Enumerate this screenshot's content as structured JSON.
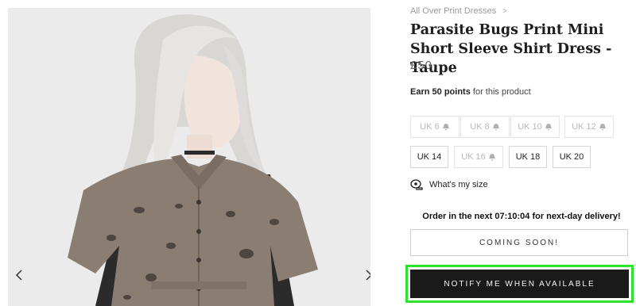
{
  "breadcrumb": {
    "category": "All Over Print Dresses",
    "separator": ">"
  },
  "product": {
    "title": "Parasite Bugs Print Mini Short Sleeve Shirt Dress - Taupe",
    "price": "£50",
    "points_prefix": "Earn",
    "points_value": "50 points",
    "points_suffix": "for this product"
  },
  "sizes": [
    {
      "label": "UK 6",
      "available": false
    },
    {
      "label": "UK 8",
      "available": false
    },
    {
      "label": "UK 10",
      "available": false
    },
    {
      "label": "UK 12",
      "available": false
    },
    {
      "label": "UK 14",
      "available": true
    },
    {
      "label": "UK 16",
      "available": false
    },
    {
      "label": "UK 18",
      "available": true
    },
    {
      "label": "UK 20",
      "available": true
    }
  ],
  "size_guide": {
    "label": "What's my size",
    "icon": "tape-measure-icon"
  },
  "delivery_note": "Order in the next 07:10:04 for next-day delivery!",
  "buttons": {
    "coming_soon": "COMING SOON!",
    "notify": "NOTIFY ME WHEN AVAILABLE"
  },
  "gallery": {
    "prev_icon": "chevron-left-icon",
    "next_icon": "chevron-right-icon"
  },
  "colors": {
    "highlight": "#2ee22e",
    "button_dark": "#1a1a1a",
    "dress_taupe": "#8a7d72"
  }
}
